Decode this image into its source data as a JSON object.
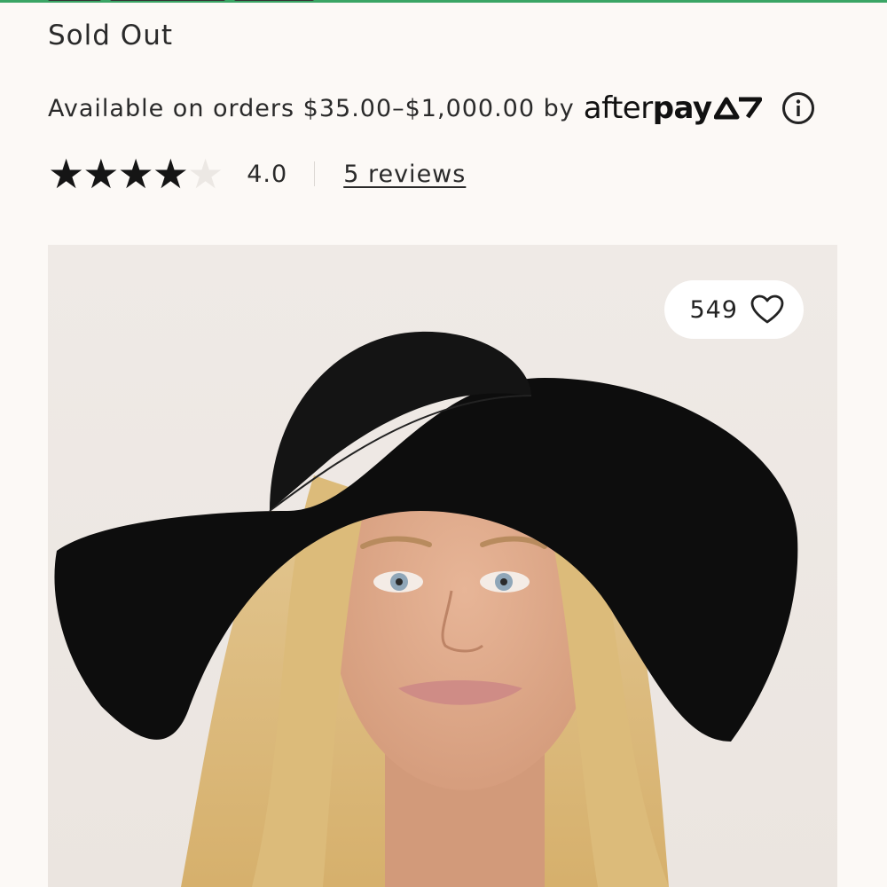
{
  "product": {
    "availability": "Sold Out"
  },
  "afterpay": {
    "text": "Available on orders $35.00–$1,000.00 by",
    "logo_text_light": "after",
    "logo_text_bold": "pay",
    "info_icon": "info-circle-icon"
  },
  "rating": {
    "value": "4.0",
    "stars_filled": 4,
    "stars_total": 5,
    "reviews_link": "5 reviews"
  },
  "image": {
    "likes": "549",
    "heart_icon": "heart-outline-icon"
  },
  "colors": {
    "background": "#fcf9f6",
    "accent_top": "#3aa565",
    "text": "#2a2a2a",
    "star_filled": "#151515",
    "star_empty": "#ece8e4"
  }
}
